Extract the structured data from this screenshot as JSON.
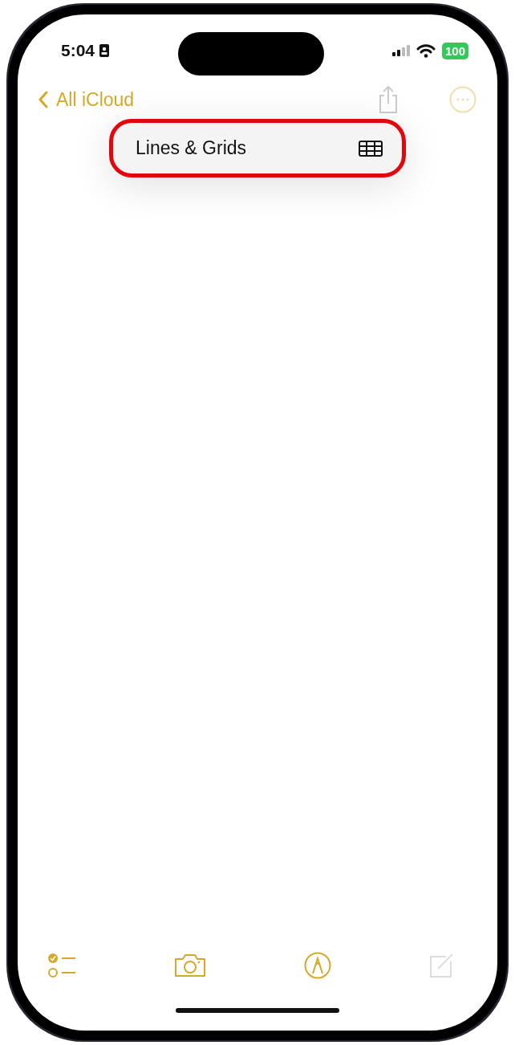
{
  "status_bar": {
    "time": "5:04",
    "battery": "100"
  },
  "nav": {
    "back_label": "All iCloud"
  },
  "menu": {
    "items": [
      {
        "label": "Lines & Grids",
        "highlighted": true
      }
    ]
  }
}
